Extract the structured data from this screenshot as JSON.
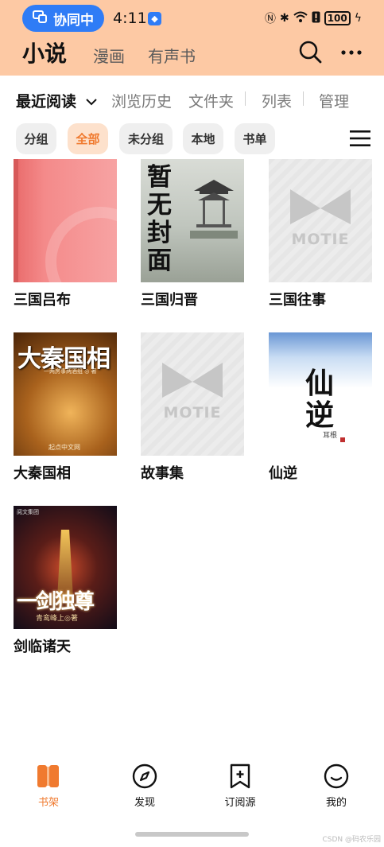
{
  "status_bar": {
    "collab_label": "协同中",
    "time": "4:11",
    "battery": "100"
  },
  "header": {
    "tabs": [
      "小说",
      "漫画",
      "有声书"
    ]
  },
  "subnav": {
    "recent": "最近阅读",
    "history": "浏览历史",
    "folder": "文件夹",
    "list": "列表",
    "manage": "管理"
  },
  "chips": [
    "分组",
    "全部",
    "未分组",
    "本地",
    "书单"
  ],
  "books": [
    {
      "title": "三国吕布"
    },
    {
      "title": "三国归晋",
      "cover_text": "暂无封面"
    },
    {
      "title": "三国往事",
      "cover_text": "MOTIE"
    },
    {
      "title": "大秦国相",
      "cover_text": "大秦国相",
      "cover_author": "一两房事两酒组 ◎ 著",
      "cover_publisher": "起点中文网"
    },
    {
      "title": "故事集",
      "cover_text": "MOTIE"
    },
    {
      "title": "仙逆",
      "cover_text": "仙逆",
      "cover_author": "耳根"
    },
    {
      "title": "剑临诸天",
      "cover_text": "一剑独尊",
      "cover_author": "青鸾峰上◎著",
      "cover_logo": "阅文集团"
    }
  ],
  "bottom_nav": {
    "bookshelf": "书架",
    "discover": "发现",
    "sources": "订阅源",
    "mine": "我的"
  },
  "watermark": "CSDN @码农乐园",
  "colors": {
    "accent": "#f07a2f",
    "header_bg": "#fdc9a4",
    "collab_pill": "#2f7cf6"
  }
}
